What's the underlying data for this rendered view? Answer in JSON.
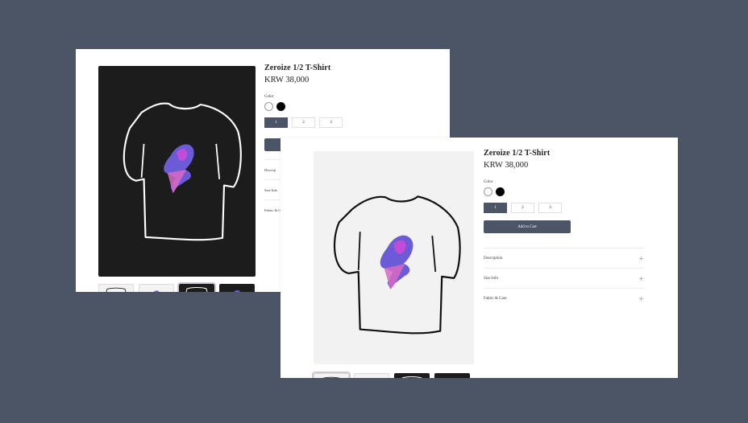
{
  "product": {
    "title": "Zeroize 1/2 T-Shirt",
    "price": "KRW 38,000",
    "color_label": "Color",
    "colors": [
      "#ffffff",
      "#000000"
    ],
    "sizes": [
      "1",
      "2",
      "3"
    ],
    "selected_size": "1",
    "add_to_cart": "Add to Cart",
    "accordion": [
      "Description",
      "Size Info",
      "Fabric & Care"
    ]
  },
  "back_card": {
    "accordion_truncated": [
      "Descrip",
      "Size Info",
      "Fabric & C"
    ],
    "thumbnails": [
      "light",
      "light",
      "dark-active",
      "dark"
    ]
  },
  "front_card": {
    "thumbnails": [
      "light-active",
      "light",
      "dark",
      "dark"
    ]
  },
  "theme": {
    "background": "#4c5565",
    "accent": "#4c5565"
  },
  "icons": {
    "plus": "plus-icon"
  }
}
